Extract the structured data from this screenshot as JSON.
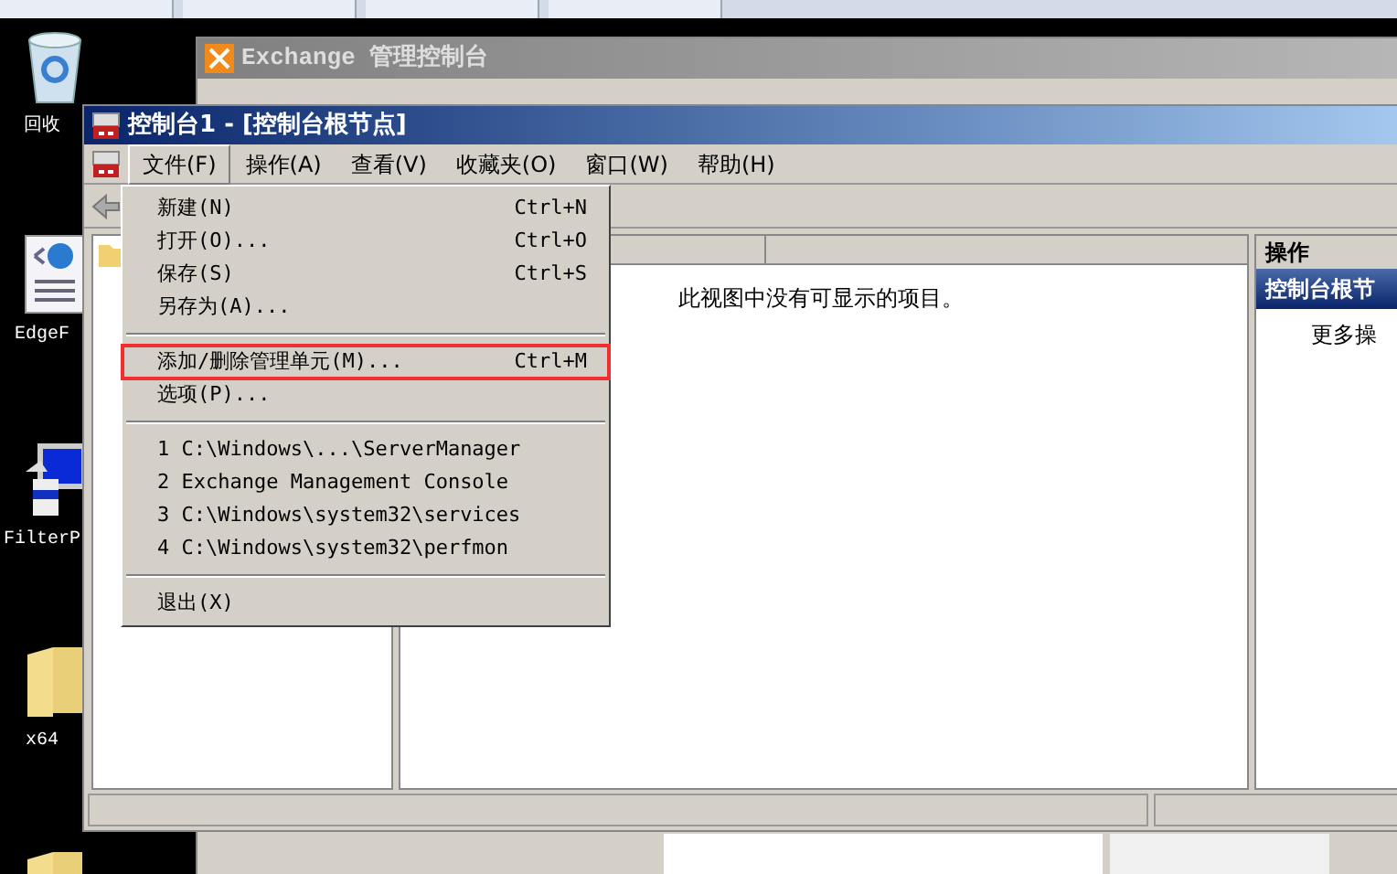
{
  "desktop_icons": [
    {
      "kind": "recycle",
      "label": "回收"
    },
    {
      "kind": "page",
      "label": "EdgeF"
    },
    {
      "kind": "computer",
      "label": "FilterP"
    },
    {
      "kind": "folder",
      "label": "x64"
    },
    {
      "kind": "folder"
    }
  ],
  "back_window": {
    "title": "Exchange 管理控制台"
  },
  "window": {
    "title": "控制台1 - [控制台根节点]"
  },
  "menu_bar": [
    {
      "label": "文件(F)",
      "selected": true
    },
    {
      "label": "操作(A)",
      "selected": false
    },
    {
      "label": "查看(V)",
      "selected": false
    },
    {
      "label": "收藏夹(O)",
      "selected": false
    },
    {
      "label": "窗口(W)",
      "selected": false
    },
    {
      "label": "帮助(H)",
      "selected": false
    }
  ],
  "file_menu": [
    {
      "kind": "item",
      "label": "新建(N)",
      "shortcut": "Ctrl+N",
      "highlighted": false
    },
    {
      "kind": "item",
      "label": "打开(O)...",
      "shortcut": "Ctrl+O",
      "highlighted": false
    },
    {
      "kind": "item",
      "label": "保存(S)",
      "shortcut": "Ctrl+S",
      "highlighted": false
    },
    {
      "kind": "item",
      "label": "另存为(A)...",
      "highlighted": false
    },
    {
      "kind": "separator"
    },
    {
      "kind": "item",
      "label": "添加/删除管理单元(M)...",
      "shortcut": "Ctrl+M",
      "highlighted": true
    },
    {
      "kind": "item",
      "label": "选项(P)...",
      "highlighted": false
    },
    {
      "kind": "separator"
    },
    {
      "kind": "item",
      "label": "1 C:\\Windows\\...\\ServerManager",
      "highlighted": false
    },
    {
      "kind": "item",
      "label": "2 Exchange Management Console",
      "highlighted": false
    },
    {
      "kind": "item",
      "label": "3 C:\\Windows\\system32\\services",
      "highlighted": false
    },
    {
      "kind": "item",
      "label": "4 C:\\Windows\\system32\\perfmon",
      "highlighted": false
    },
    {
      "kind": "separator"
    },
    {
      "kind": "item",
      "label": "退出(X)",
      "highlighted": false
    }
  ],
  "content": {
    "empty_message": "此视图中没有可显示的项目。"
  },
  "actions_pane": {
    "title": "操作",
    "section": "控制台根节",
    "items": [
      "更多操"
    ]
  }
}
